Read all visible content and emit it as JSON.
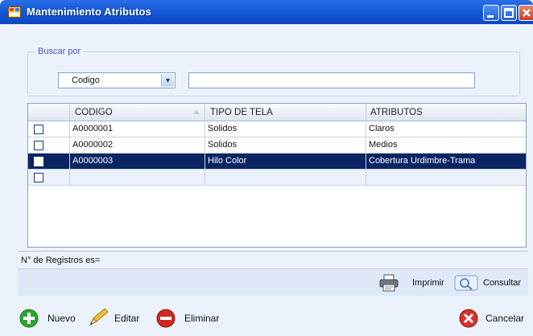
{
  "window": {
    "title": "Mantenimiento Atributos"
  },
  "search": {
    "group_label": "Buscar por",
    "field_selected": "Codigo",
    "query_value": ""
  },
  "grid": {
    "columns": [
      "CODIGO",
      "TIPO DE TELA",
      "ATRIBUTOS"
    ],
    "rows": [
      {
        "checked": false,
        "codigo": "A0000001",
        "tipo_tela": "Solidos",
        "atributos": "Claros"
      },
      {
        "checked": false,
        "codigo": "A0000002",
        "tipo_tela": "Solidos",
        "atributos": "Medios"
      },
      {
        "checked": false,
        "codigo": "A0000003",
        "tipo_tela": "Hilo Color",
        "atributos": "Cobertura Urdimbre-Trama"
      }
    ],
    "selected_row_index": 2
  },
  "status": {
    "record_count_label": "N° de Registros es="
  },
  "panel": {
    "print_label": "Imprimir",
    "query_label": "Consultar"
  },
  "actions": {
    "new_label": "Nuevo",
    "edit_label": "Editar",
    "delete_label": "Eliminar",
    "cancel_label": "Cancelar"
  },
  "icons": {
    "app": "app-form-icon",
    "print": "printer-icon",
    "query": "magnifier-icon",
    "new": "plus-circle-icon",
    "edit": "pencil-icon",
    "delete": "minus-circle-icon",
    "cancel": "x-circle-icon"
  },
  "colors": {
    "titlebar": "#1658d7",
    "selected_row": "#0b2563",
    "window_bg": "#ecf2fb"
  }
}
